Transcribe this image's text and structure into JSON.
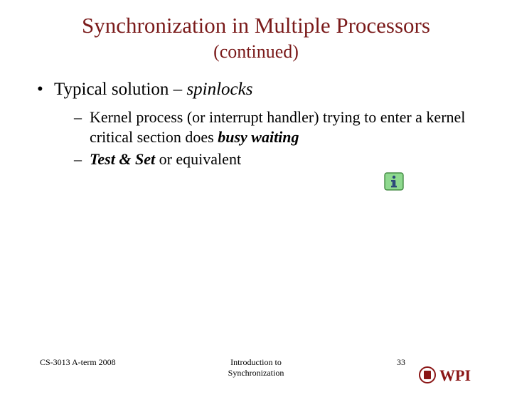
{
  "title": "Synchronization in Multiple Processors",
  "subtitle": "(continued)",
  "bullets": {
    "l1": {
      "prefix": "Typical solution – ",
      "emph": "spinlocks"
    },
    "l2": [
      {
        "seg1": "Kernel process (or interrupt handler) trying to enter a kernel critical section does ",
        "emph": "busy waiting",
        "seg2": ""
      },
      {
        "seg1": "",
        "emph": "Test & Set",
        "seg2": " or equivalent"
      }
    ]
  },
  "footer": {
    "left": "CS-3013 A-term 2008",
    "center_line1": "Introduction to",
    "center_line2": "Synchronization",
    "page": "33"
  },
  "logo_text": "WPI"
}
